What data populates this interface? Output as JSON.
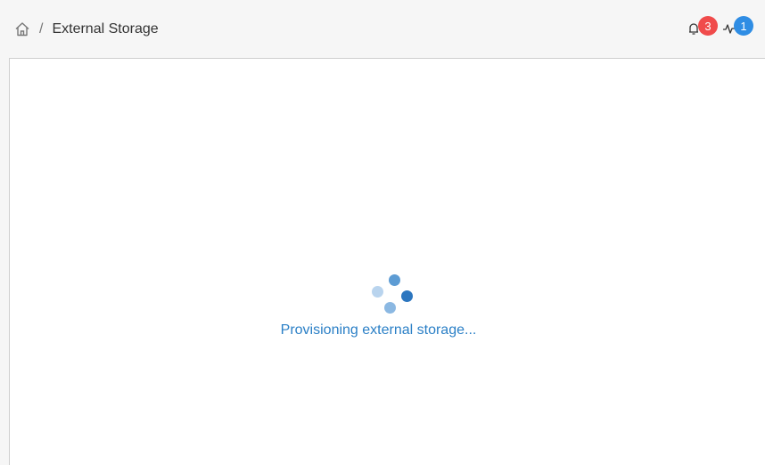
{
  "header": {
    "breadcrumb_separator": "/",
    "breadcrumb_current": "External Storage",
    "icons": {
      "home": "home-icon",
      "notifications": "bell-icon",
      "activity": "activity-icon"
    },
    "notifications_count": "3",
    "activity_count": "1",
    "colors": {
      "notification_badge": "#f04b4b",
      "activity_badge": "#2f8de4"
    }
  },
  "main": {
    "loading_message": "Provisioning external storage...",
    "accent_color": "#2a7fc6"
  }
}
